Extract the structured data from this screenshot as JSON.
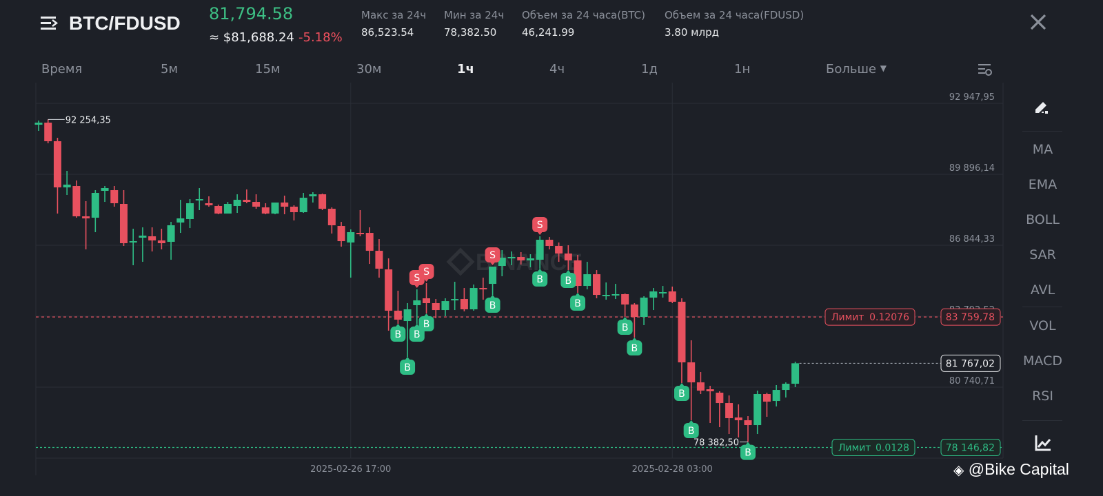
{
  "header": {
    "pair": "BTC/FDUSD",
    "last_price": "81,794.58",
    "usd_price": "≈ $81,688.24",
    "change": "-5.18%",
    "stats": [
      {
        "label": "Макс за 24ч",
        "value": "86,523.54"
      },
      {
        "label": "Мин за 24ч",
        "value": "78,382.50"
      },
      {
        "label": "Объем за 24 часа(BTC)",
        "value": "46,241.99"
      },
      {
        "label": "Объем за 24 часа(FDUSD)",
        "value": "3.80 млрд"
      }
    ]
  },
  "timeframes": {
    "items": [
      "Время",
      "5м",
      "15м",
      "30м",
      "1ч",
      "4ч",
      "1д",
      "1н"
    ],
    "active": "1ч",
    "more": "Больше"
  },
  "sidebar": {
    "items": [
      "MA",
      "EMA",
      "BOLL",
      "SAR",
      "AVL",
      "VOL",
      "MACD",
      "RSI"
    ]
  },
  "watermark": "@Bike Capital",
  "colors": {
    "up": "#2ebd85",
    "down": "#e8515f",
    "bg": "#1d2027",
    "grid": "#2a2e37"
  },
  "chart_data": {
    "type": "candlestick",
    "interval": "1h",
    "y_ticks": [
      "92 947,95",
      "89 896,14",
      "86 844,33",
      "83 792,52",
      "80 740,71"
    ],
    "y_tick_values": [
      92947.95,
      89896.14,
      86844.33,
      83792.52,
      80740.71
    ],
    "x_ticks": [
      "2025-02-26 17:00",
      "2025-02-28 03:00"
    ],
    "x_tick_index": [
      33,
      67
    ],
    "high_label": "92 254,35",
    "high_index": 1,
    "low_label": "78 382,50",
    "low_index": 75,
    "current_price": {
      "label": "81 767,02",
      "value": 81767.02
    },
    "orders": [
      {
        "side": "sell",
        "label": "Лимит",
        "qty": "0.12076",
        "price_label": "83 759,78",
        "price": 83759.78
      },
      {
        "side": "buy",
        "label": "Лимит",
        "qty": "0.0128",
        "price_label": "78 146,82",
        "price": 78146.82
      }
    ],
    "ohlc": [
      [
        92029,
        92207,
        91763,
        92118
      ],
      [
        92118,
        92254.35,
        91229,
        91318
      ],
      [
        91318,
        91466,
        88207,
        89333
      ],
      [
        89333,
        90044,
        89007,
        89451
      ],
      [
        89392,
        89629,
        88029,
        88088
      ],
      [
        88088,
        88740,
        86666,
        87999
      ],
      [
        88029,
        89214,
        87406,
        89096
      ],
      [
        89185,
        89392,
        88710,
        89303
      ],
      [
        89214,
        89392,
        88503,
        88651
      ],
      [
        88622,
        89214,
        86814,
        86932
      ],
      [
        86962,
        87555,
        85984,
        87021
      ],
      [
        87170,
        87614,
        86132,
        87258
      ],
      [
        87229,
        87614,
        86577,
        87051
      ],
      [
        87051,
        87555,
        86666,
        86932
      ],
      [
        86992,
        87851,
        86221,
        87703
      ],
      [
        87821,
        88799,
        87377,
        87999
      ],
      [
        87970,
        88829,
        87584,
        88651
      ],
      [
        88770,
        89303,
        88355,
        88829
      ],
      [
        88651,
        88948,
        88503,
        88562
      ],
      [
        88533,
        88592,
        88177,
        88207
      ],
      [
        88207,
        88710,
        88207,
        88622
      ],
      [
        88533,
        89036,
        88236,
        88799
      ],
      [
        88799,
        89244,
        88651,
        88710
      ],
      [
        88710,
        89036,
        88414,
        88503
      ],
      [
        88473,
        88651,
        88177,
        88207
      ],
      [
        88207,
        88681,
        88177,
        88681
      ],
      [
        88681,
        88977,
        88177,
        88503
      ],
      [
        88503,
        88562,
        87910,
        88266
      ],
      [
        88266,
        89096,
        88236,
        88888
      ],
      [
        88948,
        89125,
        88681,
        89036
      ],
      [
        89036,
        89066,
        88355,
        88414
      ],
      [
        88414,
        88473,
        87347,
        87703
      ],
      [
        87673,
        87851,
        86784,
        87021
      ],
      [
        86962,
        87525,
        85450,
        87406
      ],
      [
        87377,
        88355,
        87229,
        87347
      ],
      [
        87377,
        87614,
        86043,
        86606
      ],
      [
        86606,
        87110,
        85450,
        85836
      ],
      [
        85806,
        86280,
        83170,
        84029
      ],
      [
        84029,
        84888,
        83466,
        83644
      ],
      [
        83584,
        84355,
        82043,
        84088
      ],
      [
        84266,
        84947,
        83466,
        84473
      ],
      [
        84562,
        85214,
        83910,
        84355
      ],
      [
        84355,
        84532,
        83703,
        84058
      ],
      [
        84058,
        84562,
        83792,
        84443
      ],
      [
        84503,
        85273,
        84058,
        84532
      ],
      [
        84532,
        85006,
        83999,
        84088
      ],
      [
        84088,
        85154,
        84029,
        85006
      ],
      [
        85006,
        85450,
        84503,
        84947
      ],
      [
        85184,
        85924,
        84710,
        85924
      ],
      [
        85954,
        86636,
        85510,
        86310
      ],
      [
        86280,
        86577,
        85984,
        86340
      ],
      [
        86340,
        86547,
        86014,
        86192
      ],
      [
        86192,
        86458,
        85895,
        86280
      ],
      [
        86221,
        87229,
        85836,
        87081
      ],
      [
        87081,
        87199,
        86666,
        86814
      ],
      [
        86814,
        86962,
        86132,
        86488
      ],
      [
        86488,
        86844,
        85776,
        86192
      ],
      [
        86192,
        86429,
        84799,
        85095
      ],
      [
        85095,
        86132,
        84947,
        85598
      ],
      [
        85598,
        85776,
        84562,
        84710
      ],
      [
        84680,
        85244,
        84503,
        84710
      ],
      [
        84710,
        85184,
        84532,
        84740
      ],
      [
        84740,
        84769,
        83762,
        84295
      ],
      [
        84295,
        84355,
        82873,
        83762
      ],
      [
        83762,
        84651,
        83407,
        84592
      ],
      [
        84592,
        85006,
        84058,
        84858
      ],
      [
        84799,
        85095,
        84592,
        84829
      ],
      [
        84858,
        85066,
        84355,
        84414
      ],
      [
        84414,
        84562,
        80917,
        81807
      ],
      [
        81807,
        82755,
        79317,
        80947
      ],
      [
        80947,
        81392,
        80444,
        80592
      ],
      [
        80651,
        80799,
        79199,
        80562
      ],
      [
        80503,
        80562,
        79021,
        80058
      ],
      [
        80058,
        80384,
        78725,
        79406
      ],
      [
        79436,
        79999,
        78577,
        79317
      ],
      [
        79317,
        79495,
        78382.5,
        79110
      ],
      [
        79110,
        80592,
        78725,
        80444
      ],
      [
        80444,
        80503,
        79466,
        80118
      ],
      [
        80147,
        80829,
        79910,
        80621
      ],
      [
        80621,
        80947,
        80295,
        80888
      ],
      [
        80888,
        81836,
        80740,
        81767.02
      ]
    ],
    "markers": [
      {
        "i": 38,
        "type": "B"
      },
      {
        "i": 39,
        "type": "B"
      },
      {
        "i": 40,
        "type": "B"
      },
      {
        "i": 41,
        "type": "B"
      },
      {
        "i": 40,
        "type": "S"
      },
      {
        "i": 41,
        "type": "S"
      },
      {
        "i": 48,
        "type": "B"
      },
      {
        "i": 48,
        "type": "S"
      },
      {
        "i": 53,
        "type": "S"
      },
      {
        "i": 53,
        "type": "B"
      },
      {
        "i": 56,
        "type": "B"
      },
      {
        "i": 57,
        "type": "B"
      },
      {
        "i": 62,
        "type": "B"
      },
      {
        "i": 63,
        "type": "B"
      },
      {
        "i": 68,
        "type": "B"
      },
      {
        "i": 69,
        "type": "B"
      },
      {
        "i": 75,
        "type": "B"
      }
    ]
  }
}
